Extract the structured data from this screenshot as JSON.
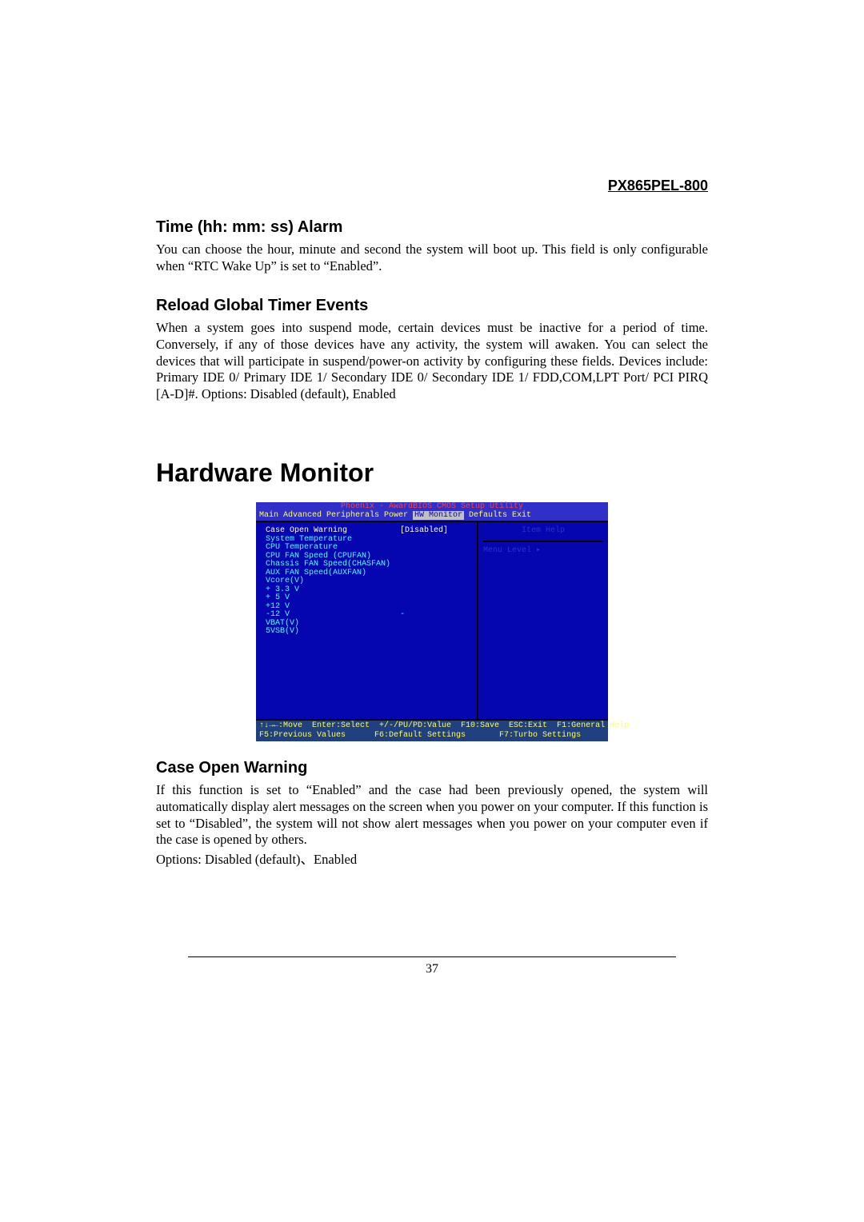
{
  "header": {
    "model": "PX865PEL-800"
  },
  "sections": {
    "time_alarm": {
      "heading": "Time (hh: mm: ss) Alarm",
      "body": "You can choose the hour, minute and second the system will boot up. This field is only configurable when “RTC Wake Up” is set to “Enabled”."
    },
    "reload_timer": {
      "heading": "Reload Global Timer Events",
      "body": "When a system goes into suspend mode, certain devices must be inactive for a period of time. Conversely, if any of those devices have any activity, the system will awaken. You can select the devices that will participate in suspend/power-on activity by configuring these fields. Devices include: Primary IDE 0/ Primary IDE 1/ Secondary IDE 0/ Secondary IDE 1/ FDD,COM,LPT Port/ PCI PIRQ [A-D]#. Options: Disabled (default), Enabled"
    },
    "hw_monitor_title": "Hardware Monitor",
    "case_open": {
      "heading": "Case Open Warning",
      "body": "If this function is set to “Enabled” and the case had been previously opened, the system will automatically display alert messages on the screen when you power on your computer. If this function is set to “Disabled”, the system will not show alert messages when you power on your computer even if the case is opened by others.",
      "options": "Options: Disabled (default)、Enabled"
    }
  },
  "bios": {
    "title": "Phoenix - AwardBIOS CMOS Setup Utility",
    "menu": {
      "items": [
        "Main",
        "Advanced",
        "Peripherals",
        "Power",
        "HW Monitor",
        "Defaults",
        "Exit"
      ],
      "selected": "HW Monitor",
      "joined_left": "Main  Advanced  Peripherals  Power ",
      "joined_right": " Defaults  Exit"
    },
    "left_rows": [
      {
        "label": "Case Open Warning",
        "value": "[Disabled]",
        "highlight": true
      },
      {
        "label": "System Temperature"
      },
      {
        "label": "CPU Temperature"
      },
      {
        "label": "CPU FAN Speed (CPUFAN)"
      },
      {
        "label": "Chassis FAN Speed(CHASFAN)"
      },
      {
        "label": "AUX FAN Speed(AUXFAN)"
      },
      {
        "label": "Vcore(V)"
      },
      {
        "label": "+ 3.3 V"
      },
      {
        "label": "+ 5 V"
      },
      {
        "label": "+12 V"
      },
      {
        "label": "-12 V",
        "value": "-"
      },
      {
        "label": "VBAT(V)"
      },
      {
        "label": "5VSB(V)"
      }
    ],
    "right": {
      "item_help": "Item Help",
      "menu_level": "Menu Level    ▸"
    },
    "footer_line1": "↑↓→←:Move  Enter:Select  +/-/PU/PD:Value  F10:Save  ESC:Exit  F1:General Help",
    "footer_line2": "F5:Previous Values      F6:Default Settings       F7:Turbo Settings"
  },
  "page_number": "37"
}
